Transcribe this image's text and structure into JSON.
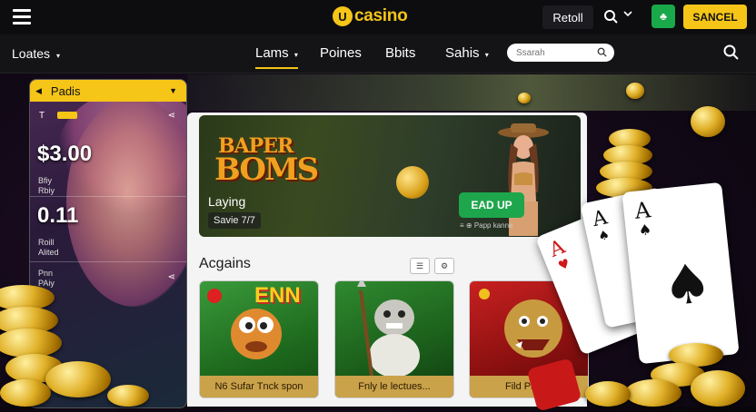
{
  "topbar": {
    "logo_mark": "U",
    "logo_text": "casino",
    "retail_label": "Retoll",
    "cancel_label": "SANCEL"
  },
  "nav": {
    "left_label": "Loates",
    "items": [
      "Lams",
      "Poines",
      "Bbits",
      "Sahis"
    ],
    "search_placeholder": "Ssarah"
  },
  "left_panel": {
    "header": "Padis",
    "row_marker": "T",
    "amount_1": "$3.00",
    "sub_1": [
      "Bfiy",
      "Rbiy"
    ],
    "amount_2": "0.11",
    "sub_2": [
      "Roill",
      "Alited"
    ],
    "sub_3": [
      "Pnn",
      "PAiy"
    ]
  },
  "banner": {
    "title_line1": "BAPER",
    "title_line2": "BOMS",
    "label": "Laying",
    "sub": "Savie 7/7",
    "button": "EAD UP",
    "note": "≡ ⊕ Papp kanne"
  },
  "section": {
    "title": "Acgains"
  },
  "games": [
    {
      "title": "N6 Sufar Tnck spon",
      "art_text": "ENN"
    },
    {
      "title": "Fnly le lectues...",
      "art_text": ""
    },
    {
      "title": "Fild Patled",
      "art_text": ""
    }
  ],
  "colors": {
    "accent": "#f5c518",
    "green": "#1ea64c",
    "topbar_bg": "#0d0d0f"
  }
}
